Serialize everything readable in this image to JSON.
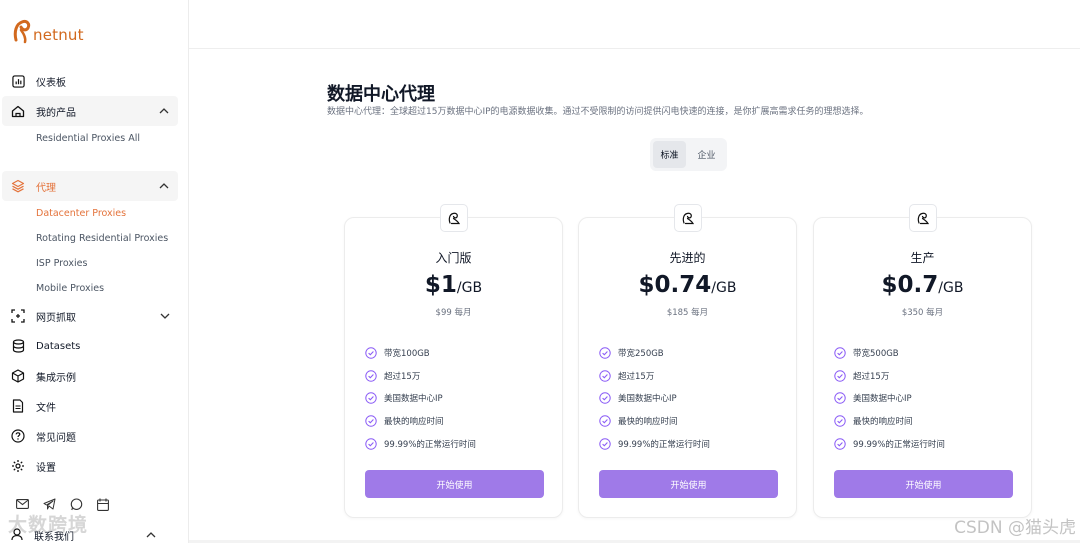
{
  "brand": {
    "name": "netnut",
    "accent": "#e4733b"
  },
  "sidebar": {
    "items": [
      {
        "label": "仪表板",
        "icon": "chart-icon"
      },
      {
        "label": "我的产品",
        "icon": "home-icon",
        "expanded": true,
        "children": [
          "Residential Proxies All"
        ]
      },
      {
        "label": "代理",
        "icon": "layers-icon",
        "expanded": true,
        "active": true,
        "children": [
          "Datacenter Proxies",
          "Rotating Residential Proxies",
          "ISP Proxies",
          "Mobile Proxies"
        ]
      },
      {
        "label": "网页抓取",
        "icon": "scan-icon"
      },
      {
        "label": "Datasets",
        "icon": "database-icon"
      },
      {
        "label": "集成示例",
        "icon": "box-icon"
      },
      {
        "label": "文件",
        "icon": "file-icon"
      },
      {
        "label": "常见问题",
        "icon": "help-icon"
      },
      {
        "label": "设置",
        "icon": "gear-icon"
      }
    ],
    "contact": "联系我们"
  },
  "page": {
    "title": "数据中心代理",
    "subtitle": "数据中心代理：全球超过15万数据中心IP的电源数据收集。通过不受限制的访问提供闪电快速的连接，是你扩展高需求任务的理想选择。",
    "toggle": {
      "options": [
        "标准",
        "企业"
      ],
      "selected": "标准"
    }
  },
  "plans": [
    {
      "name": "入门版",
      "price": "$1",
      "unit": "/GB",
      "monthly": "$99 每月",
      "features": [
        "带宽100GB",
        "超过15万",
        "美国数据中心IP",
        "最快的响应时间",
        "99.99%的正常运行时间"
      ],
      "cta": "开始使用"
    },
    {
      "name": "先进的",
      "price": "$0.74",
      "unit": "/GB",
      "monthly": "$185 每月",
      "features": [
        "带宽250GB",
        "超过15万",
        "美国数据中心IP",
        "最快的响应时间",
        "99.99%的正常运行时间"
      ],
      "cta": "开始使用"
    },
    {
      "name": "生产",
      "price": "$0.7",
      "unit": "/GB",
      "monthly": "$350 每月",
      "features": [
        "带宽500GB",
        "超过15万",
        "美国数据中心IP",
        "最快的响应时间",
        "99.99%的正常运行时间"
      ],
      "cta": "开始使用"
    }
  ],
  "colors": {
    "button": "#9f7ae8",
    "check": "#8b5cf6"
  },
  "watermarks": {
    "left": "大数跨境",
    "right": "CSDN @猫头虎"
  }
}
